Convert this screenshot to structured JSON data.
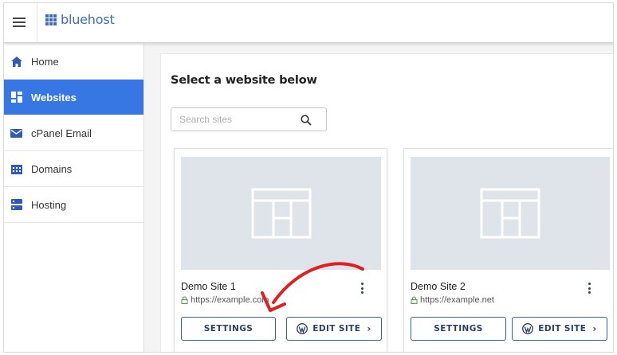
{
  "topbar": {
    "logo_text": "bluehost",
    "brand_color": "#3e6bc6"
  },
  "sidebar": {
    "items": [
      {
        "label": "Home",
        "icon": "home-icon",
        "active": false
      },
      {
        "label": "Websites",
        "icon": "websites-icon",
        "active": true
      },
      {
        "label": "cPanel Email",
        "icon": "email-icon",
        "active": false
      },
      {
        "label": "Domains",
        "icon": "domains-icon",
        "active": false
      },
      {
        "label": "Hosting",
        "icon": "hosting-icon",
        "active": false
      }
    ],
    "active_color": "#3677e3"
  },
  "main": {
    "title": "Select a website below",
    "search": {
      "placeholder": "Search sites",
      "value": ""
    },
    "sites": [
      {
        "name": "Demo Site 1",
        "url": "https://example.com",
        "settings_label": "SETTINGS",
        "edit_label": "EDIT SITE"
      },
      {
        "name": "Demo Site 2",
        "url": "https://example.net",
        "settings_label": "SETTINGS",
        "edit_label": "EDIT SITE"
      }
    ]
  },
  "annotation": {
    "arrow_color": "#e02020"
  }
}
